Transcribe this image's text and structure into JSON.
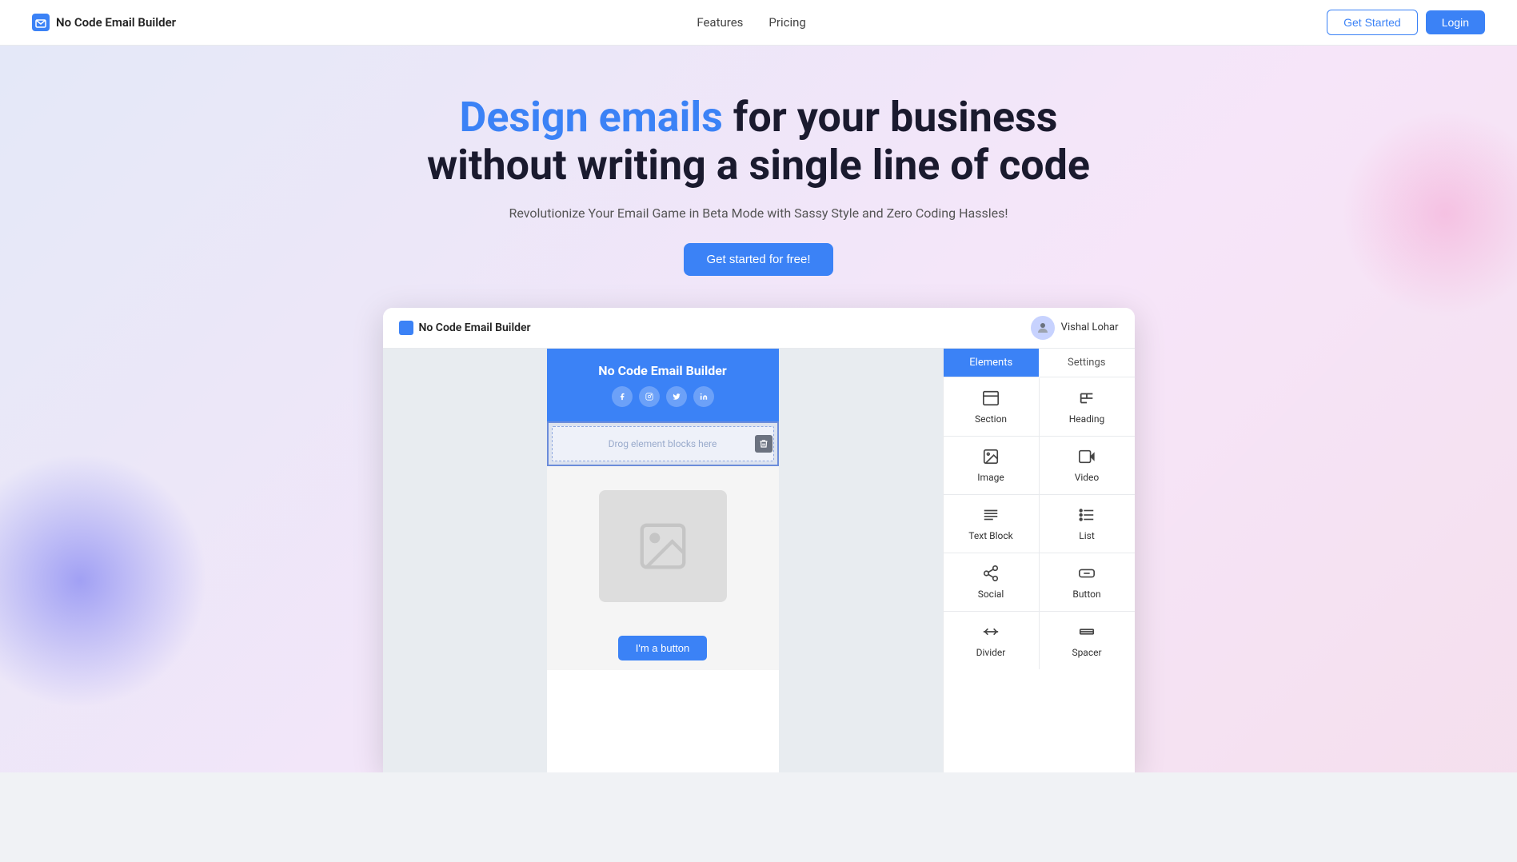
{
  "navbar": {
    "logo_text": "No Code Email Builder",
    "nav_links": [
      "Features",
      "Pricing"
    ],
    "get_started_label": "Get Started",
    "login_label": "Login"
  },
  "hero": {
    "title_normal": " for your business without writing a single line of code",
    "title_accent": "Design emails",
    "subtitle": "Revolutionize Your Email Game in Beta Mode with Sassy Style and Zero Coding Hassles!",
    "cta_label": "Get started for free!"
  },
  "app_window": {
    "logo_text": "No Code Email Builder",
    "user_name": "Vishal Lohar",
    "email_header_title": "No Code Email Builder",
    "social_icons": [
      "f",
      "ig",
      "tw",
      "in"
    ],
    "drop_zone_text": "Drog element blocks here",
    "elements_tab": "Elements",
    "settings_tab": "Settings",
    "elements": [
      {
        "icon": "⬛",
        "label": "Section"
      },
      {
        "icon": "H",
        "label": "Heading"
      },
      {
        "icon": "🖼",
        "label": "Image"
      },
      {
        "icon": "▶",
        "label": "Video"
      },
      {
        "icon": "≡",
        "label": "Text Block"
      },
      {
        "icon": "☰",
        "label": "List"
      },
      {
        "icon": "✚",
        "label": "Social"
      },
      {
        "icon": "☐",
        "label": "Button"
      },
      {
        "icon": "⟺",
        "label": "Divider"
      },
      {
        "icon": "⬜",
        "label": "Spacer"
      }
    ],
    "email_button_label": "I'm a button"
  }
}
